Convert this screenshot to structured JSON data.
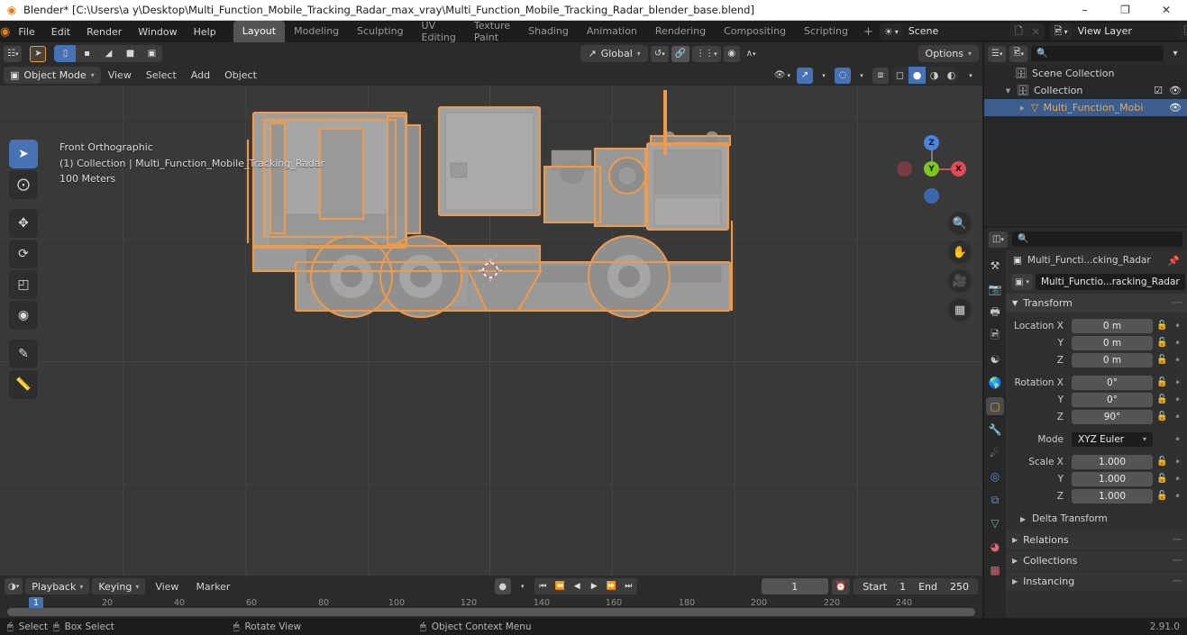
{
  "window": {
    "title": "Blender* [C:\\Users\\a y\\Desktop\\Multi_Function_Mobile_Tracking_Radar_max_vray\\Multi_Function_Mobile_Tracking_Radar_blender_base.blend]",
    "logo_icon": "blender-logo-icon",
    "minimize": "–",
    "maximize": "❐",
    "close": "✕"
  },
  "topbar": {
    "logo_icon": "blender-logo-icon",
    "menus": [
      "File",
      "Edit",
      "Render",
      "Window",
      "Help"
    ],
    "workspaces": [
      {
        "label": "Layout",
        "active": true
      },
      {
        "label": "Modeling",
        "active": false
      },
      {
        "label": "Sculpting",
        "active": false
      },
      {
        "label": "UV Editing",
        "active": false
      },
      {
        "label": "Texture Paint",
        "active": false
      },
      {
        "label": "Shading",
        "active": false
      },
      {
        "label": "Animation",
        "active": false
      },
      {
        "label": "Rendering",
        "active": false
      },
      {
        "label": "Compositing",
        "active": false
      },
      {
        "label": "Scripting",
        "active": false
      }
    ],
    "add_workspace": "+",
    "scene": {
      "icon": "scene-icon",
      "name": "Scene",
      "new_icon": "new-scene-icon",
      "unlink_icon": "unlink-icon"
    },
    "view_layer": {
      "icon": "view-layer-icon",
      "name": "View Layer",
      "new_icon": "new-layer-icon",
      "unlink_icon": "unlink-icon"
    }
  },
  "viewport": {
    "editor_type_icon": "editor-type-icon",
    "transform_tool_icon": "tweak-tool-icon",
    "select_modes": [
      {
        "name": "select-box-icon",
        "on": true
      },
      {
        "name": "select-vertex-icon",
        "on": false
      },
      {
        "name": "select-edge-icon",
        "on": false
      },
      {
        "name": "select-face-icon",
        "on": false
      },
      {
        "name": "select-extend-icon",
        "on": false
      }
    ],
    "orientation": {
      "icon": "orientation-icon",
      "label": "Global",
      "chevron": "⌄"
    },
    "pivot_icon": "pivot-icon",
    "snap_icon": "magnet-icon",
    "snap_to_icon": "snap-increment-icon",
    "proportional_icon": "proportional-edit-icon",
    "falloff_icon": "falloff-curve-icon",
    "options_label": "Options",
    "mode": {
      "icon": "object-mode-icon",
      "label": "Object Mode",
      "chevron": "⌄"
    },
    "menus": [
      "View",
      "Select",
      "Add",
      "Object"
    ],
    "visibility_icon": "show-hide-icon",
    "gizmo_icon": "gizmo-icon",
    "overlays_icon": "overlays-icon",
    "xray_icon": "xray-toggle-icon",
    "shading_modes": [
      {
        "name": "wireframe-shading-icon",
        "on": false
      },
      {
        "name": "solid-shading-icon",
        "on": true
      },
      {
        "name": "material-preview-icon",
        "on": false
      },
      {
        "name": "rendered-shading-icon",
        "on": false
      }
    ],
    "overlay_text": {
      "view": "Front Orthographic",
      "collection": "(1) Collection | Multi_Function_Mobile_Tracking_Radar",
      "scale": "100 Meters"
    },
    "tools": [
      {
        "name": "tool-tweak",
        "glyph": "➤",
        "on": true
      },
      {
        "name": "tool-cursor",
        "glyph": "⊕",
        "on": false
      },
      {
        "name": "tool-move",
        "glyph": "✥",
        "on": false
      },
      {
        "name": "tool-rotate",
        "glyph": "↻",
        "on": false
      },
      {
        "name": "tool-scale",
        "glyph": "◰",
        "on": false
      },
      {
        "name": "tool-transform",
        "glyph": "◉",
        "on": false
      },
      {
        "name": "tool-annotate",
        "glyph": "✎",
        "on": false
      },
      {
        "name": "tool-measure",
        "glyph": "▙",
        "on": false
      }
    ],
    "gizmo_axes": [
      {
        "label": "Z",
        "color": "#4b84e0"
      },
      {
        "label": "Y",
        "color": "#7bc81e"
      },
      {
        "label": "X",
        "color": "#e04b57"
      }
    ],
    "nav_buttons": [
      {
        "name": "zoom-view-icon",
        "glyph": "⌕"
      },
      {
        "name": "pan-view-icon",
        "glyph": "✋"
      },
      {
        "name": "camera-view-icon",
        "glyph": "▣"
      },
      {
        "name": "toggle-ortho-icon",
        "glyph": "▦"
      }
    ],
    "selection_color": "#ed9a4b",
    "model_name": "Multi_Function_Mobile_Tracking_Radar"
  },
  "timeline": {
    "editor_icon": "timeline-editor-icon",
    "menus": [
      {
        "label": "Playback",
        "chevron": "⌄"
      },
      {
        "label": "Keying",
        "chevron": "⌄"
      },
      {
        "label": "View",
        "chevron": ""
      },
      {
        "label": "Marker",
        "chevron": ""
      }
    ],
    "record_icon": "auto-keying-icon",
    "transport": [
      {
        "name": "jump-start-button",
        "glyph": "⏮"
      },
      {
        "name": "prev-keyframe-button",
        "glyph": "⏪"
      },
      {
        "name": "play-reverse-button",
        "glyph": "◀"
      },
      {
        "name": "play-button",
        "glyph": "▶"
      },
      {
        "name": "next-keyframe-button",
        "glyph": "⏩"
      },
      {
        "name": "jump-end-button",
        "glyph": "⏭"
      }
    ],
    "current_frame": "1",
    "clock_icon": "use-preview-range-icon",
    "start_label": "Start",
    "start_value": "1",
    "end_label": "End",
    "end_value": "250",
    "ruler_ticks": [
      "20",
      "40",
      "60",
      "80",
      "100",
      "120",
      "140",
      "160",
      "180",
      "200",
      "220",
      "240"
    ],
    "playhead_label": "1"
  },
  "outliner": {
    "display_mode_icon": "outliner-display-mode-icon",
    "filter_id_icon": "filter-id-icon",
    "search_placeholder": "",
    "search_icon": "search-icon",
    "filter_icon": "filter-funnel-icon",
    "rows": [
      {
        "indent": 0,
        "tri": "",
        "icon": "scene-collection-icon",
        "label": "Scene Collection",
        "checkbox": false,
        "eye": false,
        "selected": false
      },
      {
        "indent": 1,
        "tri": "▼",
        "icon": "collection-icon",
        "label": "Collection",
        "checkbox": true,
        "eye": true,
        "selected": false
      },
      {
        "indent": 2,
        "tri": "▶",
        "icon": "mesh-object-icon",
        "label": "Multi_Function_Mobi",
        "checkbox": false,
        "eye": true,
        "selected": true
      }
    ]
  },
  "properties": {
    "editor_icon": "properties-editor-icon",
    "search_icon": "search-icon",
    "search_placeholder": "",
    "tabs": [
      {
        "name": "tool-tab",
        "glyph": "⚒",
        "color": "#c8c8c8",
        "on": false
      },
      {
        "name": "render-tab",
        "glyph": "▣",
        "color": "#c8c8c8",
        "on": false
      },
      {
        "name": "output-tab",
        "glyph": "⎙",
        "color": "#c8c8c8",
        "on": false
      },
      {
        "name": "view-layer-tab",
        "glyph": "⬚",
        "color": "#c8c8c8",
        "on": false
      },
      {
        "name": "scene-tab",
        "glyph": "⌾",
        "color": "#c8c8c8",
        "on": false
      },
      {
        "name": "world-tab",
        "glyph": "●",
        "color": "#d06a7a",
        "on": false
      },
      {
        "name": "object-tab",
        "glyph": "▢",
        "color": "#e8a33d",
        "on": true
      },
      {
        "name": "modifier-tab",
        "glyph": "⚙",
        "color": "#5a8fd8",
        "on": false
      },
      {
        "name": "particles-tab",
        "glyph": "⁂",
        "color": "#b8b8c8",
        "on": false
      },
      {
        "name": "physics-tab",
        "glyph": "◎",
        "color": "#5a8fd8",
        "on": false
      },
      {
        "name": "constraints-tab",
        "glyph": "⧉",
        "color": "#6a8fc8",
        "on": false
      },
      {
        "name": "data-tab",
        "glyph": "▽",
        "color": "#4fbf7f",
        "on": false
      },
      {
        "name": "material-tab",
        "glyph": "◕",
        "color": "#d06a7a",
        "on": false
      },
      {
        "name": "texture-tab",
        "glyph": "▦",
        "color": "#d06a7a",
        "on": false
      }
    ],
    "breadcrumb_icon": "object-icon",
    "breadcrumb_label": "Multi_Functi...cking_Radar",
    "pin_icon": "pin-icon",
    "object_id_icon": "object-data-icon",
    "object_id_name": "Multi_Functio...racking_Radar",
    "transform": {
      "title": "Transform",
      "expand_icon": "▼",
      "rows": [
        {
          "label": "Location X",
          "value": "0 m",
          "lock": "unlocked-icon",
          "anim": "animate-dot"
        },
        {
          "label": "Y",
          "value": "0 m",
          "lock": "unlocked-icon",
          "anim": "animate-dot"
        },
        {
          "label": "Z",
          "value": "0 m",
          "lock": "unlocked-icon",
          "anim": "animate-dot"
        },
        {
          "label": "Rotation X",
          "value": "0°",
          "lock": "unlocked-icon",
          "anim": "animate-dot"
        },
        {
          "label": "Y",
          "value": "0°",
          "lock": "unlocked-icon",
          "anim": "animate-dot"
        },
        {
          "label": "Z",
          "value": "90°",
          "lock": "unlocked-icon",
          "anim": "animate-dot"
        }
      ],
      "mode_label": "Mode",
      "mode_value": "XYZ Euler",
      "scale_rows": [
        {
          "label": "Scale X",
          "value": "1.000",
          "lock": "unlocked-icon",
          "anim": "animate-dot"
        },
        {
          "label": "Y",
          "value": "1.000",
          "lock": "unlocked-icon",
          "anim": "animate-dot"
        },
        {
          "label": "Z",
          "value": "1.000",
          "lock": "unlocked-icon",
          "anim": "animate-dot"
        }
      ],
      "delta_label": "Delta Transform"
    },
    "panels": [
      {
        "label": "Relations",
        "tri": "▶"
      },
      {
        "label": "Collections",
        "tri": "▶"
      },
      {
        "label": "Instancing",
        "tri": "▶"
      }
    ]
  },
  "statusbar": {
    "items": [
      {
        "icon": "mouse-left-icon",
        "label": "Select"
      },
      {
        "icon": "mouse-left-drag-icon",
        "label": "Box Select"
      },
      {
        "icon": "mouse-middle-icon",
        "label": "Rotate View"
      },
      {
        "icon": "mouse-right-icon",
        "label": "Object Context Menu"
      }
    ],
    "version": "2.91.0"
  }
}
